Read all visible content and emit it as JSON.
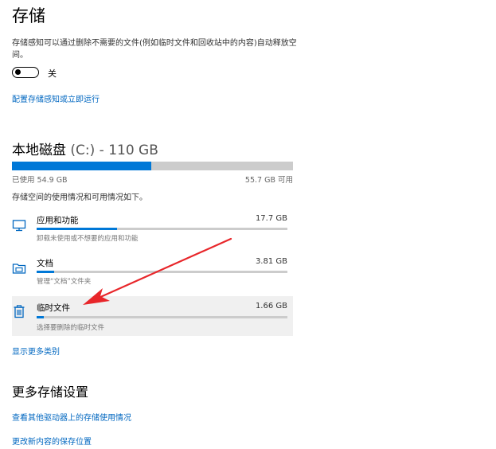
{
  "page": {
    "title": "存储"
  },
  "storage_sense": {
    "description": "存储感知可以通过删除不需要的文件(例如临时文件和回收站中的内容)自动释放空间。",
    "toggle_state_label": "关",
    "toggle_on": false,
    "configure_link": "配置存储感知或立即运行"
  },
  "drive": {
    "title": "本地磁盘",
    "subtitle": "(C:) - 110 GB",
    "used_label": "已使用 54.9 GB",
    "free_label": "55.7 GB 可用",
    "used_fraction": 0.496,
    "usage_note": "存储空间的使用情况和可用情况如下。"
  },
  "categories": [
    {
      "name": "应用和功能",
      "size": "17.7 GB",
      "description": "卸载未使用或不想要的应用和功能",
      "fraction": 0.32,
      "icon": "monitor-icon",
      "highlight": false
    },
    {
      "name": "文档",
      "size": "3.81 GB",
      "description": "管理“文档”文件夹",
      "fraction": 0.07,
      "icon": "documents-folder-icon",
      "highlight": false
    },
    {
      "name": "临时文件",
      "size": "1.66 GB",
      "description": "选择要删除的临时文件",
      "fraction": 0.03,
      "icon": "trash-icon",
      "highlight": true
    }
  ],
  "show_more_link": "显示更多类别",
  "more_settings": {
    "title": "更多存储设置",
    "links": [
      "查看其他驱动器上的存储使用情况",
      "更改新内容的保存位置"
    ]
  },
  "colors": {
    "accent": "#0078d7",
    "link": "#0067c0",
    "bar_track": "#cccccc",
    "highlight_bg": "#f0f0f0",
    "annotation_arrow": "#e8262a"
  }
}
